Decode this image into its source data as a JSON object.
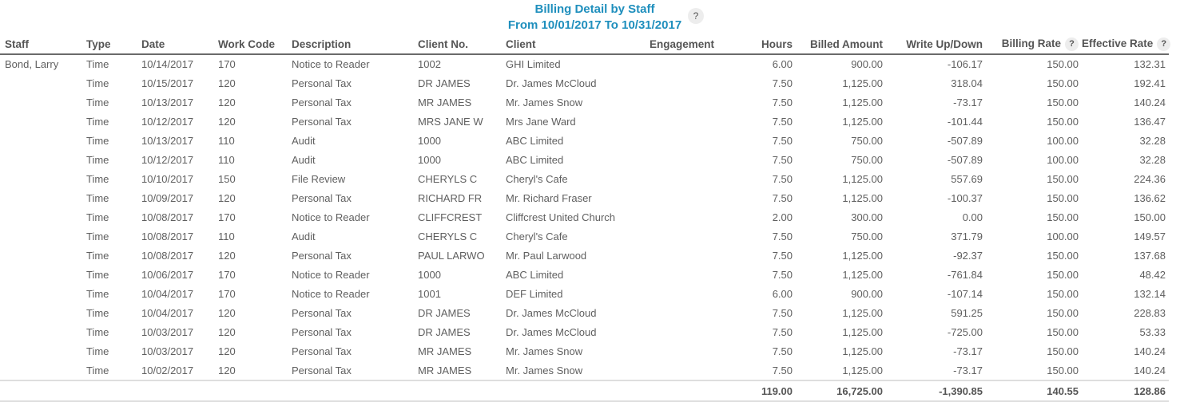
{
  "report": {
    "title": "Billing Detail by Staff",
    "subtitle": "From 10/01/2017 To 10/31/2017",
    "help_label": "?"
  },
  "columns": {
    "staff": "Staff",
    "type": "Type",
    "date": "Date",
    "work_code": "Work Code",
    "description": "Description",
    "client_no": "Client No.",
    "client": "Client",
    "engagement": "Engagement",
    "hours": "Hours",
    "billed_amount": "Billed Amount",
    "write_up_down": "Write Up/Down",
    "billing_rate": "Billing Rate",
    "effective_rate": "Effective Rate",
    "help_label": "?"
  },
  "rows": [
    {
      "staff": "Bond, Larry",
      "type": "Time",
      "date": "10/14/2017",
      "work_code": "170",
      "description": "Notice to Reader",
      "client_no": "1002",
      "client": "GHI Limited",
      "engagement": "",
      "hours": "6.00",
      "billed_amount": "900.00",
      "write_up_down": "-106.17",
      "billing_rate": "150.00",
      "effective_rate": "132.31"
    },
    {
      "staff": "",
      "type": "Time",
      "date": "10/15/2017",
      "work_code": "120",
      "description": "Personal Tax",
      "client_no": "DR JAMES",
      "client": "Dr. James McCloud",
      "engagement": "",
      "hours": "7.50",
      "billed_amount": "1,125.00",
      "write_up_down": "318.04",
      "billing_rate": "150.00",
      "effective_rate": "192.41"
    },
    {
      "staff": "",
      "type": "Time",
      "date": "10/13/2017",
      "work_code": "120",
      "description": "Personal Tax",
      "client_no": "MR JAMES",
      "client": "Mr. James Snow",
      "engagement": "",
      "hours": "7.50",
      "billed_amount": "1,125.00",
      "write_up_down": "-73.17",
      "billing_rate": "150.00",
      "effective_rate": "140.24"
    },
    {
      "staff": "",
      "type": "Time",
      "date": "10/12/2017",
      "work_code": "120",
      "description": "Personal Tax",
      "client_no": "MRS JANE W",
      "client": "Mrs Jane Ward",
      "engagement": "",
      "hours": "7.50",
      "billed_amount": "1,125.00",
      "write_up_down": "-101.44",
      "billing_rate": "150.00",
      "effective_rate": "136.47"
    },
    {
      "staff": "",
      "type": "Time",
      "date": "10/13/2017",
      "work_code": "110",
      "description": "Audit",
      "client_no": "1000",
      "client": "ABC Limited",
      "engagement": "",
      "hours": "7.50",
      "billed_amount": "750.00",
      "write_up_down": "-507.89",
      "billing_rate": "100.00",
      "effective_rate": "32.28"
    },
    {
      "staff": "",
      "type": "Time",
      "date": "10/12/2017",
      "work_code": "110",
      "description": "Audit",
      "client_no": "1000",
      "client": "ABC Limited",
      "engagement": "",
      "hours": "7.50",
      "billed_amount": "750.00",
      "write_up_down": "-507.89",
      "billing_rate": "100.00",
      "effective_rate": "32.28"
    },
    {
      "staff": "",
      "type": "Time",
      "date": "10/10/2017",
      "work_code": "150",
      "description": "File Review",
      "client_no": "CHERYLS C",
      "client": "Cheryl's Cafe",
      "engagement": "",
      "hours": "7.50",
      "billed_amount": "1,125.00",
      "write_up_down": "557.69",
      "billing_rate": "150.00",
      "effective_rate": "224.36"
    },
    {
      "staff": "",
      "type": "Time",
      "date": "10/09/2017",
      "work_code": "120",
      "description": "Personal Tax",
      "client_no": "RICHARD FR",
      "client": "Mr. Richard Fraser",
      "engagement": "",
      "hours": "7.50",
      "billed_amount": "1,125.00",
      "write_up_down": "-100.37",
      "billing_rate": "150.00",
      "effective_rate": "136.62"
    },
    {
      "staff": "",
      "type": "Time",
      "date": "10/08/2017",
      "work_code": "170",
      "description": "Notice to Reader",
      "client_no": "CLIFFCREST",
      "client": "Cliffcrest United Church",
      "engagement": "",
      "hours": "2.00",
      "billed_amount": "300.00",
      "write_up_down": "0.00",
      "billing_rate": "150.00",
      "effective_rate": "150.00"
    },
    {
      "staff": "",
      "type": "Time",
      "date": "10/08/2017",
      "work_code": "110",
      "description": "Audit",
      "client_no": "CHERYLS C",
      "client": "Cheryl's Cafe",
      "engagement": "",
      "hours": "7.50",
      "billed_amount": "750.00",
      "write_up_down": "371.79",
      "billing_rate": "100.00",
      "effective_rate": "149.57"
    },
    {
      "staff": "",
      "type": "Time",
      "date": "10/08/2017",
      "work_code": "120",
      "description": "Personal Tax",
      "client_no": "PAUL LARWO",
      "client": "Mr. Paul Larwood",
      "engagement": "",
      "hours": "7.50",
      "billed_amount": "1,125.00",
      "write_up_down": "-92.37",
      "billing_rate": "150.00",
      "effective_rate": "137.68"
    },
    {
      "staff": "",
      "type": "Time",
      "date": "10/06/2017",
      "work_code": "170",
      "description": "Notice to Reader",
      "client_no": "1000",
      "client": "ABC Limited",
      "engagement": "",
      "hours": "7.50",
      "billed_amount": "1,125.00",
      "write_up_down": "-761.84",
      "billing_rate": "150.00",
      "effective_rate": "48.42"
    },
    {
      "staff": "",
      "type": "Time",
      "date": "10/04/2017",
      "work_code": "170",
      "description": "Notice to Reader",
      "client_no": "1001",
      "client": "DEF Limited",
      "engagement": "",
      "hours": "6.00",
      "billed_amount": "900.00",
      "write_up_down": "-107.14",
      "billing_rate": "150.00",
      "effective_rate": "132.14"
    },
    {
      "staff": "",
      "type": "Time",
      "date": "10/04/2017",
      "work_code": "120",
      "description": "Personal Tax",
      "client_no": "DR JAMES",
      "client": "Dr. James McCloud",
      "engagement": "",
      "hours": "7.50",
      "billed_amount": "1,125.00",
      "write_up_down": "591.25",
      "billing_rate": "150.00",
      "effective_rate": "228.83"
    },
    {
      "staff": "",
      "type": "Time",
      "date": "10/03/2017",
      "work_code": "120",
      "description": "Personal Tax",
      "client_no": "DR JAMES",
      "client": "Dr. James McCloud",
      "engagement": "",
      "hours": "7.50",
      "billed_amount": "1,125.00",
      "write_up_down": "-725.00",
      "billing_rate": "150.00",
      "effective_rate": "53.33"
    },
    {
      "staff": "",
      "type": "Time",
      "date": "10/03/2017",
      "work_code": "120",
      "description": "Personal Tax",
      "client_no": "MR JAMES",
      "client": "Mr. James Snow",
      "engagement": "",
      "hours": "7.50",
      "billed_amount": "1,125.00",
      "write_up_down": "-73.17",
      "billing_rate": "150.00",
      "effective_rate": "140.24"
    },
    {
      "staff": "",
      "type": "Time",
      "date": "10/02/2017",
      "work_code": "120",
      "description": "Personal Tax",
      "client_no": "MR JAMES",
      "client": "Mr. James Snow",
      "engagement": "",
      "hours": "7.50",
      "billed_amount": "1,125.00",
      "write_up_down": "-73.17",
      "billing_rate": "150.00",
      "effective_rate": "140.24"
    }
  ],
  "totals": {
    "hours": "119.00",
    "billed_amount": "16,725.00",
    "write_up_down": "-1,390.85",
    "billing_rate": "140.55",
    "effective_rate": "128.86"
  },
  "colors": {
    "title": "#1f8fbd",
    "text": "#555555",
    "help_badge_bg": "#ededed"
  }
}
